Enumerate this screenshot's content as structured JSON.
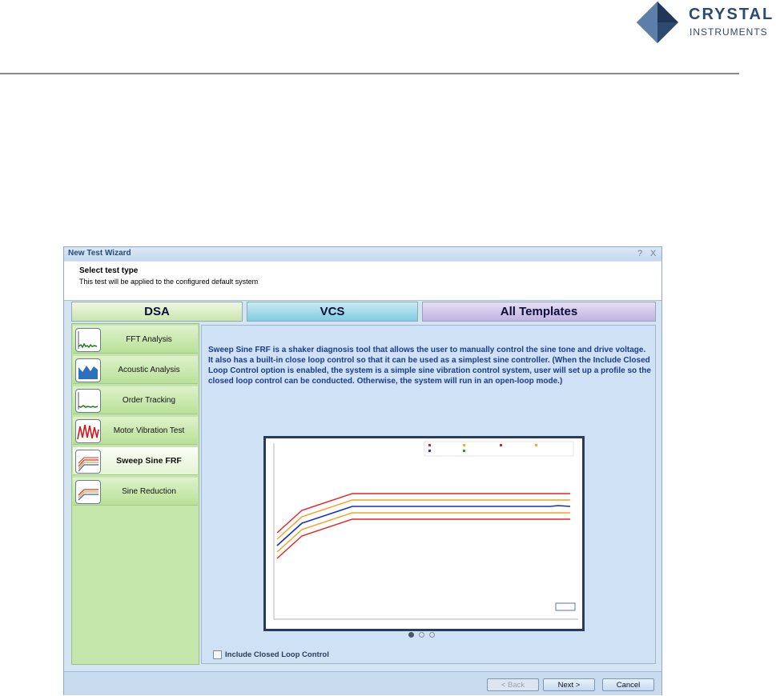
{
  "brand": {
    "line1": "CRYSTAL",
    "line2": "INSTRUMENTS"
  },
  "window": {
    "title": "New Test Wizard",
    "help": "?",
    "close": "X",
    "header_title": "Select test type",
    "header_subtitle": "This test will be applied to the configured default system"
  },
  "tabs": [
    {
      "label": "DSA",
      "color": "#cbe6ad"
    },
    {
      "label": "VCS",
      "color": "#7fcde0"
    },
    {
      "label": "All  Templates",
      "color": "#c1b2e1"
    }
  ],
  "test_types": [
    {
      "label": "FFT Analysis",
      "icon": "fft-icon"
    },
    {
      "label": "Acoustic Analysis",
      "icon": "acoustic-icon"
    },
    {
      "label": "Order Tracking",
      "icon": "order-tracking-icon"
    },
    {
      "label": "Motor Vibration Test",
      "icon": "motor-vibration-icon"
    },
    {
      "label": "Sweep  Sine  FRF",
      "icon": "sweep-sine-icon",
      "selected": true
    },
    {
      "label": "Sine Reduction",
      "icon": "sine-reduction-icon"
    }
  ],
  "description": "Sweep Sine FRF is a shaker diagnosis  tool that allows the user to manually  control the sine tone and drive voltage. It also has a built-in close loop control so that it can be used as a simplest sine controller. (When the Include Closed Loop Control option is enabled, the system is a simple sine vibration control system, user will set up a profile so the closed loop control can be conducted. Otherwise, the system will run in an open-loop mode.)",
  "carousel": {
    "pages": 3,
    "active": 1
  },
  "option": {
    "label": "Include Closed Loop Control",
    "checked": false
  },
  "buttons": {
    "back": "< Back",
    "next": "Next >",
    "cancel": "Cancel"
  }
}
